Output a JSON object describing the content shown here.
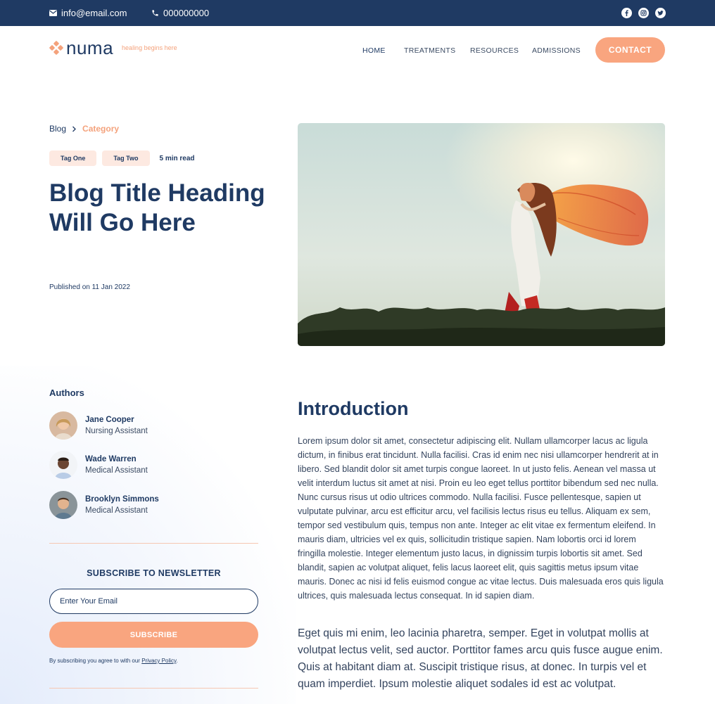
{
  "topbar": {
    "email": "info@email.com",
    "phone": "000000000",
    "social_icons": [
      "facebook-icon",
      "instagram-icon",
      "twitter-icon"
    ],
    "background": "#1f3a63"
  },
  "header": {
    "logo_name": "numa",
    "tagline": "healing begins here",
    "nav": [
      {
        "label": "HOME",
        "active": true
      },
      {
        "label": "TREATMENTS",
        "active": false
      },
      {
        "label": "RESOURCES",
        "active": false
      },
      {
        "label": "ADMISSIONS",
        "active": false
      }
    ],
    "contact_label": "CONTACT",
    "accent": "#f9a57f"
  },
  "hero": {
    "breadcrumb": {
      "root": "Blog",
      "current": "Category"
    },
    "tags": [
      "Tag One",
      "Tag Two"
    ],
    "read_time": "5 min read",
    "title": "Blog Title Heading Will Go Here",
    "published": "Published on 11 Jan 2022"
  },
  "sidebar": {
    "authors_heading": "Authors",
    "authors": [
      {
        "name": "Jane Cooper",
        "role": "Nursing Assistant"
      },
      {
        "name": "Wade Warren",
        "role": "Medical Assistant"
      },
      {
        "name": "Brooklyn Simmons",
        "role": "Medical Assistant"
      }
    ],
    "newsletter": {
      "heading": "SUBSCRIBE TO NEWSLETTER",
      "placeholder": "Enter Your Email",
      "button": "SUBSCRIBE",
      "note": "By subscribing you agree to with our",
      "policy_link": "Privacy Policy",
      "note_end": "."
    }
  },
  "article": {
    "heading": "Introduction",
    "paragraph1": "Lorem ipsum dolor sit amet, consectetur adipiscing elit. Nullam ullamcorper lacus ac ligula dictum, in finibus erat tincidunt. Nulla facilisi. Cras id enim nec nisi ullamcorper hendrerit at in libero. Sed blandit dolor sit amet turpis congue laoreet. In ut justo felis. Aenean vel massa ut velit interdum luctus sit amet at nisi. Proin eu leo eget tellus porttitor bibendum sed nec nulla. Nunc cursus risus ut odio ultrices commodo. Nulla facilisi. Fusce pellentesque, sapien ut vulputate pulvinar, arcu est efficitur arcu, vel facilisis lectus risus eu tellus. Aliquam ex sem, tempor sed vestibulum quis, tempus non ante. Integer ac elit vitae ex fermentum eleifend. In mauris diam, ultricies vel ex quis, sollicitudin tristique sapien. Nam lobortis orci id lorem fringilla molestie. Integer elementum justo lacus, in dignissim turpis lobortis sit amet. Sed blandit, sapien ac volutpat aliquet, felis lacus laoreet elit, quis sagittis metus ipsum vitae mauris. Donec ac nisi id felis euismod congue ac vitae lectus. Duis malesuada eros quis ligula ultrices, quis malesuada lectus consequat. In id sapien diam.",
    "paragraph2": "Eget quis mi enim, leo lacinia pharetra, semper. Eget in volutpat mollis at volutpat lectus velit, sed auctor. Porttitor fames arcu quis fusce augue enim. Quis at habitant diam at. Suscipit tristique risus, at donec. In turpis vel et quam imperdiet. Ipsum molestie aliquet sodales id est ac volutpat."
  }
}
